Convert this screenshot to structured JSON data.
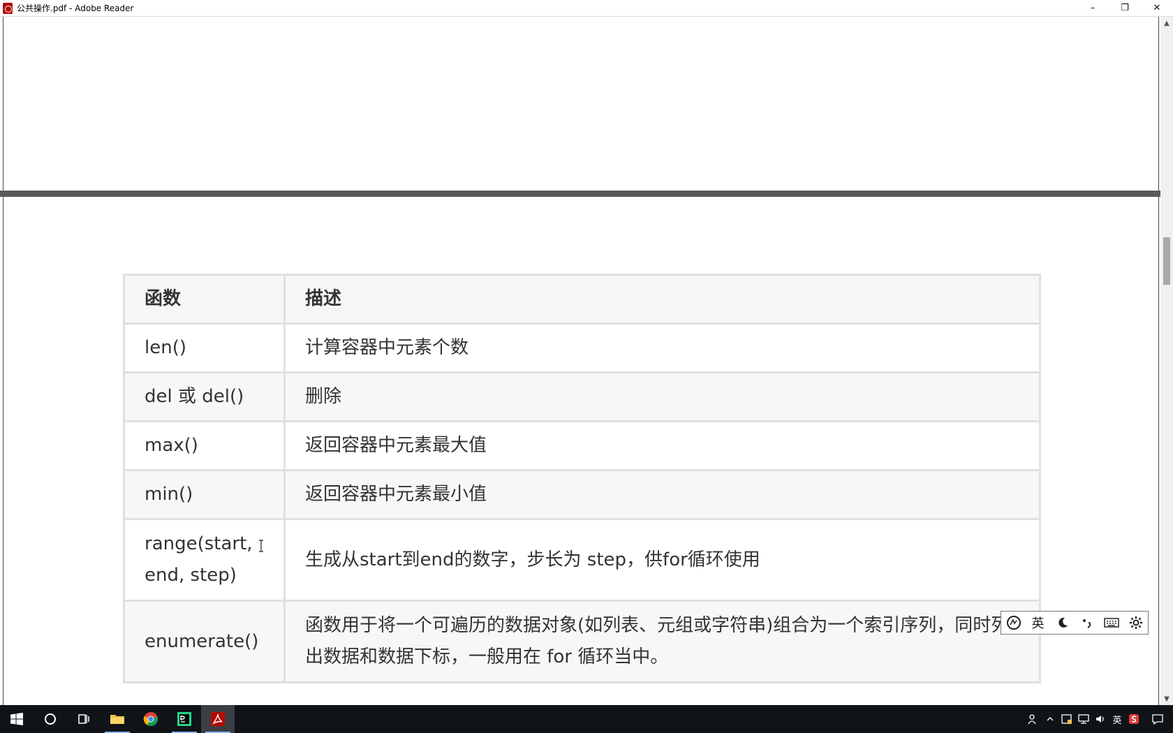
{
  "window": {
    "title": "公共操作.pdf - Adobe Reader",
    "controls": {
      "minimize": "–",
      "restore": "❐",
      "close": "✕"
    }
  },
  "table": {
    "headers": [
      "函数",
      "描述"
    ],
    "rows": [
      {
        "func": "len()",
        "desc": "计算容器中元素个数"
      },
      {
        "func": "del 或 del()",
        "desc": "删除"
      },
      {
        "func": "max()",
        "desc": "返回容器中元素最大值"
      },
      {
        "func": "min()",
        "desc": "返回容器中元素最小值"
      },
      {
        "func": "range(start, end, step)",
        "desc": "生成从start到end的数字，步长为 step，供for循环使用"
      },
      {
        "func": "enumerate()",
        "desc": "函数用于将一个可遍历的数据对象(如列表、元组或字符串)组合为一个索引序列，同时列出数据和数据下标，一般用在 for 循环当中。"
      }
    ]
  },
  "ime": {
    "mode": "英",
    "icons": [
      "ime-logo-icon",
      "moon-icon",
      "punctuation-icon",
      "keyboard-icon",
      "settings-icon"
    ]
  },
  "taskbar": {
    "apps": [
      "windows-start-icon",
      "search-circle-icon",
      "task-view-icon",
      "file-explorer-icon",
      "chrome-icon",
      "pycharm-icon",
      "adobe-reader-icon"
    ],
    "tray": {
      "ime_label": "英"
    }
  },
  "colors": {
    "taskbar_bg": "#101418",
    "table_border": "#e0e0e0",
    "text": "#333333",
    "acrobat_red": "#b30b00",
    "page_gap": "#5a5a5a"
  }
}
